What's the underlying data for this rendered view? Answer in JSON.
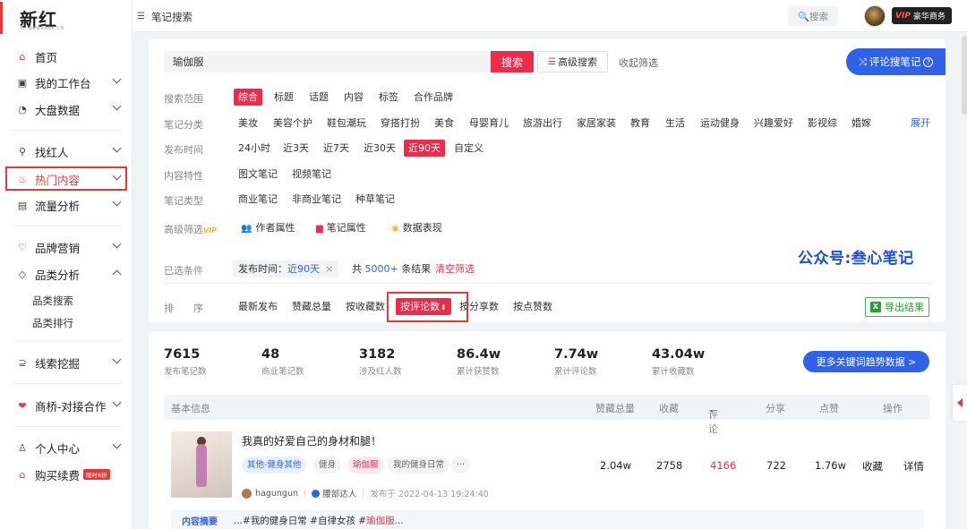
{
  "logo": {
    "brand": "新红",
    "sub": "XH.NEWRANK.CN"
  },
  "topbar": {
    "breadcrumb": "笔记搜索",
    "search_placeholder": "🔍搜索",
    "vip_badge": "VIP",
    "vip_label": "豪华商务"
  },
  "sidebar": {
    "items": [
      {
        "label": "首页",
        "icon": "home-icon"
      },
      {
        "label": "我的工作台",
        "icon": "workbench-icon"
      },
      {
        "label": "大盘数据",
        "icon": "dashboard-icon"
      },
      {
        "label": "找红人",
        "icon": "search-person-icon"
      },
      {
        "label": "热门内容",
        "icon": "fire-icon"
      },
      {
        "label": "流量分析",
        "icon": "chart-icon"
      },
      {
        "label": "品牌营销",
        "icon": "brand-icon"
      },
      {
        "label": "品类分析",
        "icon": "tag-icon"
      },
      {
        "label": "线索挖掘",
        "icon": "clue-icon"
      },
      {
        "label": "商桥-对接合作",
        "icon": "handshake-icon"
      },
      {
        "label": "个人中心",
        "icon": "user-icon"
      },
      {
        "label": "购买续费",
        "icon": "cart-icon"
      }
    ],
    "sub_items": [
      "品类搜索",
      "品类排行"
    ],
    "renew_badge": "限时6折"
  },
  "search": {
    "value": "瑜伽服",
    "button": "搜索",
    "advanced": "高级搜索",
    "collapse": "收起筛选",
    "comment_search": "评论搜笔记"
  },
  "filters": {
    "scope": {
      "label": "搜索范围",
      "options": [
        "综合",
        "标题",
        "话题",
        "内容",
        "标签",
        "合作品牌"
      ]
    },
    "category": {
      "label": "笔记分类",
      "options": [
        "美妆",
        "美容个护",
        "鞋包潮玩",
        "穿搭打扮",
        "美食",
        "母婴育儿",
        "旅游出行",
        "家居家装",
        "教育",
        "生活",
        "运动健身",
        "兴趣爱好",
        "影视综",
        "婚嫁"
      ],
      "expand": "展开"
    },
    "time": {
      "label": "发布时间",
      "options": [
        "24小时",
        "近3天",
        "近7天",
        "近30天",
        "近90天",
        "自定义"
      ]
    },
    "feature": {
      "label": "内容特性",
      "options": [
        "图文笔记",
        "视频笔记"
      ]
    },
    "type": {
      "label": "笔记类型",
      "options": [
        "商业笔记",
        "非商业笔记",
        "种草笔记"
      ]
    },
    "advanced": {
      "label": "高级筛选",
      "vip": "VIP",
      "options": [
        "作者属性",
        "笔记属性",
        "数据表现"
      ]
    },
    "selected": {
      "label": "已选条件",
      "chip_key": "发布时间：",
      "chip_value": "近90天",
      "chip_close": "×",
      "total_prefix": "共",
      "total_count": "5000+",
      "total_suffix": "条结果",
      "clear": "清空筛选"
    },
    "sort": {
      "label": "排　　序",
      "options": [
        "最新发布",
        "赞藏总量",
        "按收藏数",
        "按评论数",
        "按分享数",
        "按点赞数"
      ],
      "sort_arrow": "⬇",
      "export": "导出结果"
    }
  },
  "watermark": "公众号:叁心笔记",
  "stats": [
    {
      "value": "7615",
      "caption": "发布笔记数"
    },
    {
      "value": "48",
      "caption": "商业笔记数"
    },
    {
      "value": "3182",
      "caption": "涉及红人数"
    },
    {
      "value": "86.4w",
      "caption": "累计获赞数"
    },
    {
      "value": "7.74w",
      "caption": "累计评论数"
    },
    {
      "value": "43.04w",
      "caption": "累计收藏数"
    }
  ],
  "more_button": "更多关键词趋势数据 >",
  "table": {
    "headers": [
      "基本信息",
      "赞藏总量",
      "收藏",
      "评论",
      "分享",
      "点赞",
      "操作"
    ],
    "sort_marker": "▾",
    "row": {
      "title": "我真的好爱自己的身材和腿！",
      "tags": [
        "其他-健身其他",
        "健身",
        "瑜伽服",
        "我的健身日常",
        "···"
      ],
      "author": "hagungun",
      "author_tier": "腰部达人",
      "published": "发布于 2022-04-13 19:24:40",
      "likes_collects": "2.04w",
      "collects": "2758",
      "comments": "4166",
      "shares": "722",
      "likes": "1.76w",
      "action_collect": "收藏",
      "action_detail": "详情",
      "summary_label": "内容摘要",
      "summary_pre": "...#我的健身日常 #自律女孩 #",
      "summary_hl": "瑜伽服",
      "summary_post": "..."
    }
  },
  "colors": {
    "accent": "#ec2c4a",
    "primary_blue": "#2f62e6"
  }
}
